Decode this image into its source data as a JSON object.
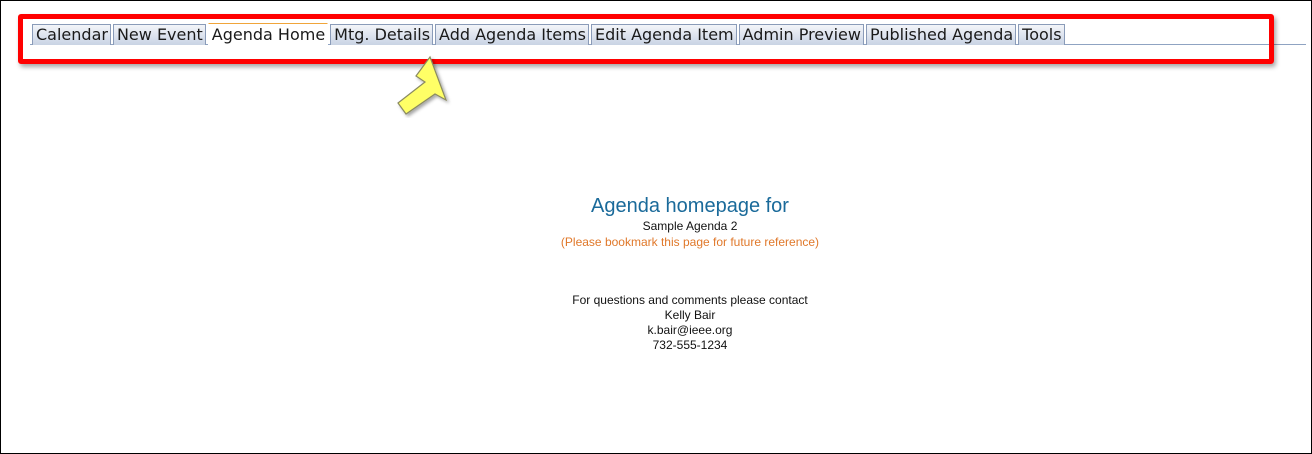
{
  "tabs": [
    {
      "label": "Calendar",
      "active": false
    },
    {
      "label": "New Event",
      "active": false
    },
    {
      "label": "Agenda Home",
      "active": true
    },
    {
      "label": "Mtg. Details",
      "active": false
    },
    {
      "label": "Add Agenda Items",
      "active": false
    },
    {
      "label": "Edit Agenda Item",
      "active": false
    },
    {
      "label": "Admin Preview",
      "active": false
    },
    {
      "label": "Published Agenda",
      "active": false
    },
    {
      "label": "Tools",
      "active": false
    }
  ],
  "annotation": {
    "highlight_color": "#ff0000",
    "arrow_color": "#ffff66",
    "arrow_icon": "yellow-arrow-icon"
  },
  "main": {
    "heading": "Agenda homepage for",
    "agenda_name": "Sample Agenda 2",
    "bookmark_note": "(Please bookmark this page for future reference)",
    "contact": {
      "intro": "For questions and comments please contact",
      "name": "Kelly Bair",
      "email": "k.bair@ieee.org",
      "phone": "732-555-1234"
    }
  },
  "colors": {
    "heading": "#1a6a9a",
    "note": "#e0782a",
    "tab_border": "#8a9bb8"
  }
}
